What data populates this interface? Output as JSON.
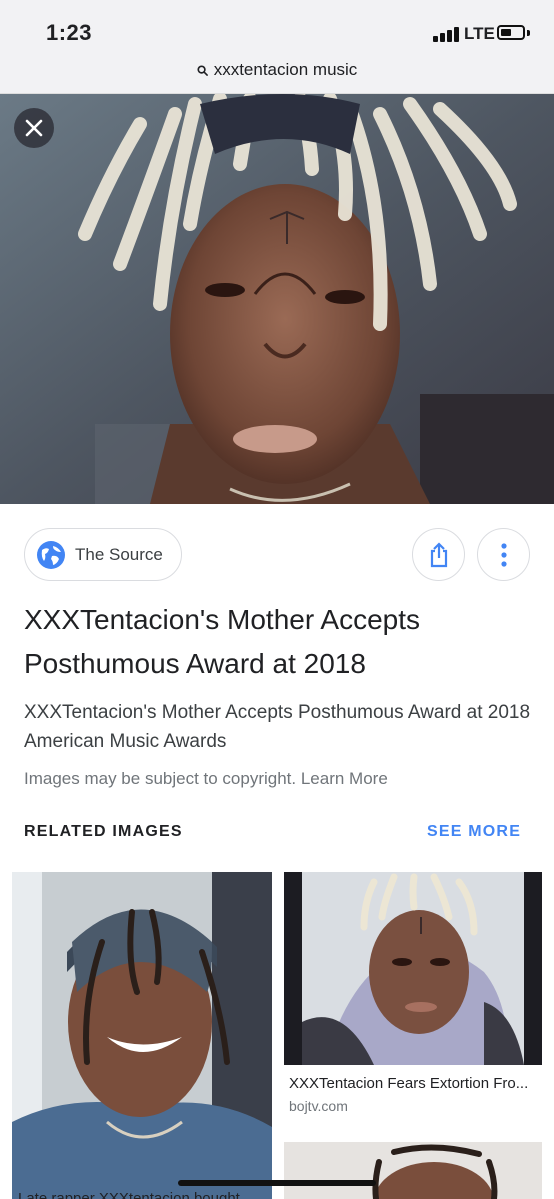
{
  "status": {
    "time": "1:23",
    "network": "LTE"
  },
  "query": {
    "text": "xxxtentacion music",
    "icon": "search-icon"
  },
  "viewer": {
    "close_icon": "close-icon",
    "source": {
      "name": "The Source",
      "icon": "globe-icon"
    },
    "share_icon": "share-icon",
    "more_icon": "more-vert-icon",
    "title": "XXXTentacion's Mother Accepts Posthumous Award at 2018",
    "description": "XXXTentacion's Mother Accepts Posthumous Award at 2018 American Music Awards",
    "copyright_notice": "Images may be subject to copyright. Learn More"
  },
  "related": {
    "label": "RELATED IMAGES",
    "see_more": "SEE MORE",
    "items": [
      {
        "caption": "Late rapper XXXtentacion bought"
      },
      {
        "caption": "XXXTentacion Fears Extortion Fro...",
        "domain": "bojtv.com"
      },
      {
        "caption": ""
      }
    ]
  },
  "colors": {
    "accent": "#4285f4",
    "status_bg": "#f2f2f4",
    "text_primary": "#202124",
    "text_secondary": "#70757a"
  }
}
